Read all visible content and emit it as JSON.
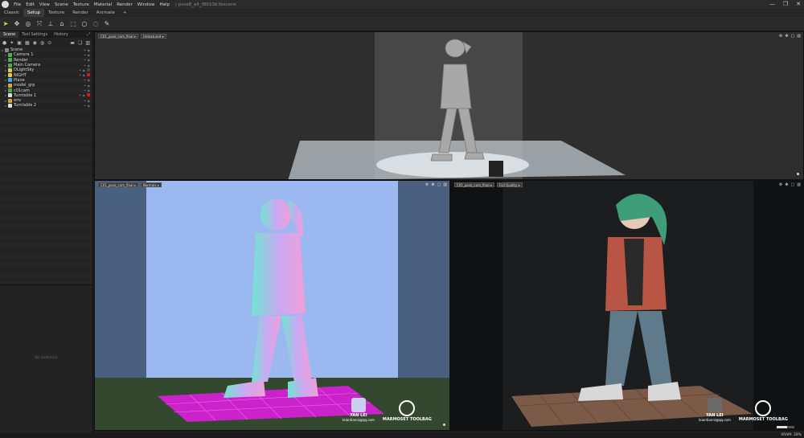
{
  "window": {
    "menu": [
      "File",
      "Edit",
      "View",
      "Scene",
      "Texture",
      "Material",
      "Render",
      "Window",
      "Help"
    ],
    "doc_title": "| pose8_alt_f8010b.tbscene",
    "controls": [
      "—",
      "❐",
      "✕"
    ]
  },
  "mode_tabs": [
    "Classic",
    "Setup",
    "Texture",
    "Render",
    "Animate",
    "+"
  ],
  "left_panel": {
    "tabs": [
      "Scene",
      "Tool Settings",
      "History"
    ],
    "tree": [
      {
        "label": "Scene",
        "level": 0,
        "color": "#888888",
        "flag": ""
      },
      {
        "label": "Camera 1",
        "level": 1,
        "color": "#4caf50",
        "flag": ""
      },
      {
        "label": "Render",
        "level": 1,
        "color": "#4caf50",
        "flag": ""
      },
      {
        "label": "Main Camera",
        "level": 1,
        "color": "#4caf50",
        "flag": ""
      },
      {
        "label": "DLightSky",
        "level": 1,
        "color": "#e8c840",
        "flag": "dark"
      },
      {
        "label": "NIGHT",
        "level": 1,
        "color": "#e8c840",
        "flag": "red"
      },
      {
        "label": "Plane",
        "level": 1,
        "color": "#3fa9f5",
        "flag": ""
      },
      {
        "label": "model_grp",
        "level": 1,
        "color": "#d9a441",
        "flag": ""
      },
      {
        "label": "c01cam",
        "level": 1,
        "color": "#4caf50",
        "flag": ""
      },
      {
        "label": "Turntable 1",
        "level": 1,
        "color": "#dddddd",
        "flag": "red"
      },
      {
        "label": "env",
        "level": 1,
        "color": "#d9a441",
        "flag": ""
      },
      {
        "label": "Turntable 2",
        "level": 1,
        "color": "#dddddd",
        "flag": ""
      }
    ],
    "no_selection": "No Selection"
  },
  "viewports": {
    "top": {
      "camera": "C01_pose_cam_final ▾",
      "mode": "Untextured ▾"
    },
    "bottom_left": {
      "camera": "C01_pose_cam_final ▾",
      "mode": "Normals ▾"
    },
    "bottom_right": {
      "camera": "C01_pose_cam_final ▾",
      "mode": "Full Quality ▾"
    }
  },
  "watermark": {
    "artist": "YAN LEI",
    "email": "leiantianni@qq.com",
    "brand": "MARMOSET TOOLBAG"
  },
  "status": {
    "vram": "VRAM: 28%",
    "progress": 0.6
  },
  "colors": {
    "accent": "#d7e64a",
    "magenta_grid": "#cc22cc",
    "normals_bg": "#9cb8f0"
  }
}
